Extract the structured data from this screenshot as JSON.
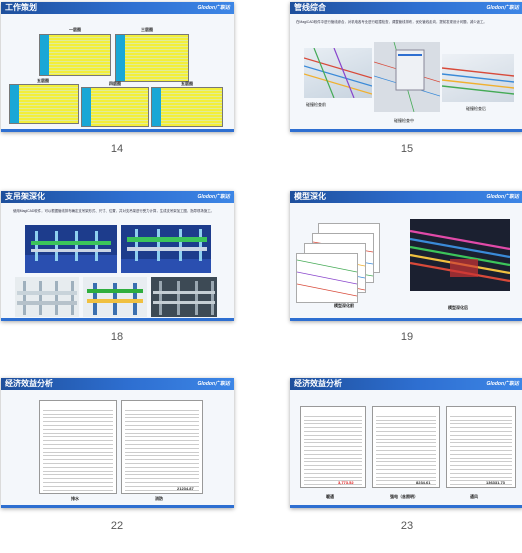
{
  "slides": [
    {
      "title": "工作策划",
      "logo": "Glodon广联达",
      "number": "14",
      "tables": [
        "一层图",
        "三层图",
        "五层图",
        "四层图",
        "五层图"
      ]
    },
    {
      "title": "管线综合",
      "logo": "Glodon广联达",
      "number": "15",
      "paragraph": "在MagiCAD软件中进行管线综合，对机电各专业进行碰撞检查，调整管线排布，优化管线走向，提前发现设计问题，减少返工。",
      "captions": [
        "碰撞检查前",
        "碰撞检查中",
        "碰撞检查后"
      ]
    },
    {
      "title": "支吊架深化",
      "logo": "Glodon广联达",
      "number": "18",
      "paragraph": "使用MagiCAD软件，可以根据管线排布确定支吊架形式、尺寸、位置，并对支吊架进行受力计算，生成支吊架加工图，指导现场施工。"
    },
    {
      "title": "模型深化",
      "logo": "Glodon广联达",
      "number": "19",
      "captions": [
        "模型深化前",
        "模型深化后"
      ]
    },
    {
      "title": "经济效益分析",
      "logo": "Glodon广联达",
      "number": "22",
      "captions": [
        "排水",
        "消防"
      ],
      "totals": [
        "",
        "21234.87"
      ]
    },
    {
      "title": "经济效益分析",
      "logo": "Glodon广联达",
      "number": "23",
      "captions": [
        "暖通",
        "强电（含照明）",
        "通风"
      ],
      "totals": [
        "3,773.52",
        "8234.61",
        "136331.73"
      ]
    }
  ]
}
